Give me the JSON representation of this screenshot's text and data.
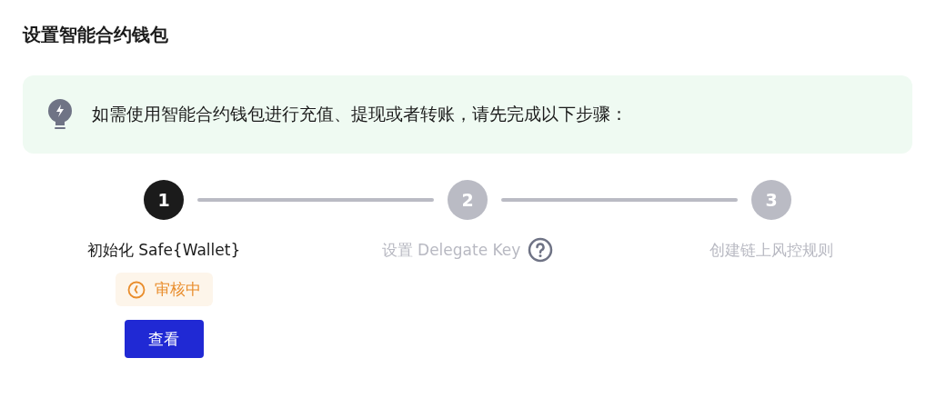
{
  "title": "设置智能合约钱包",
  "notice": {
    "text": "如需使用智能合约钱包进行充值、提现或者转账，请先完成以下步骤："
  },
  "steps": [
    {
      "number": "1",
      "label": "初始化 Safe{Wallet}",
      "current": true,
      "help": false,
      "badge": {
        "text": "审核中"
      },
      "button": "查看"
    },
    {
      "number": "2",
      "label": "设置 Delegate Key",
      "current": false,
      "help": true
    },
    {
      "number": "3",
      "label": "创建链上风控规则",
      "current": false,
      "help": false
    }
  ]
}
